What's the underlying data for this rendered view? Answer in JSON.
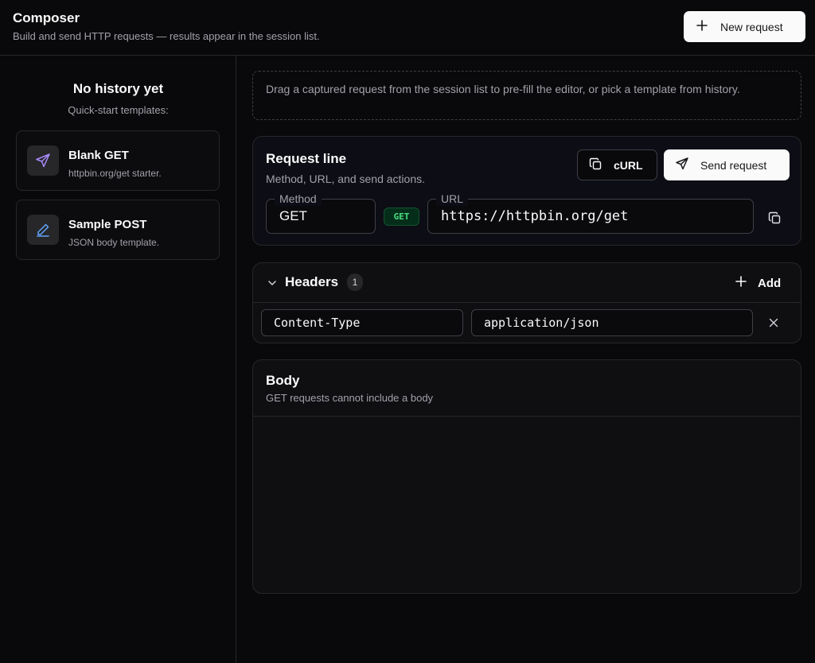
{
  "header": {
    "title": "Composer",
    "subtitle": "Build and send HTTP requests — results appear in the session list.",
    "new_request_label": "New request"
  },
  "sidebar": {
    "empty_title": "No history yet",
    "templates_label": "Quick-start templates:",
    "templates": [
      {
        "name": "Blank GET",
        "description": "httpbin.org/get starter.",
        "icon": "send-icon",
        "icon_color": "#a78bfa"
      },
      {
        "name": "Sample POST",
        "description": "JSON body template.",
        "icon": "pencil-icon",
        "icon_color": "#60a5fa"
      }
    ]
  },
  "main": {
    "hint": "Drag a captured request from the session list to pre-fill the editor, or pick a template from history.",
    "request_line": {
      "title": "Request line",
      "subtitle": "Method, URL, and send actions.",
      "curl_label": "cURL",
      "send_label": "Send request",
      "method_label": "Method",
      "method_value": "GET",
      "method_badge": "GET",
      "url_label": "URL",
      "url_value": "https://httpbin.org/get"
    },
    "headers": {
      "title": "Headers",
      "count": "1",
      "add_label": "Add",
      "items": [
        {
          "key": "Content-Type",
          "value": "application/json"
        }
      ]
    },
    "body": {
      "title": "Body",
      "subtitle": "GET requests cannot include a body"
    }
  },
  "colors": {
    "background": "#09090b",
    "border": "#27272a",
    "accent_primary": "#fafafa",
    "badge_get": "#4ade80"
  }
}
